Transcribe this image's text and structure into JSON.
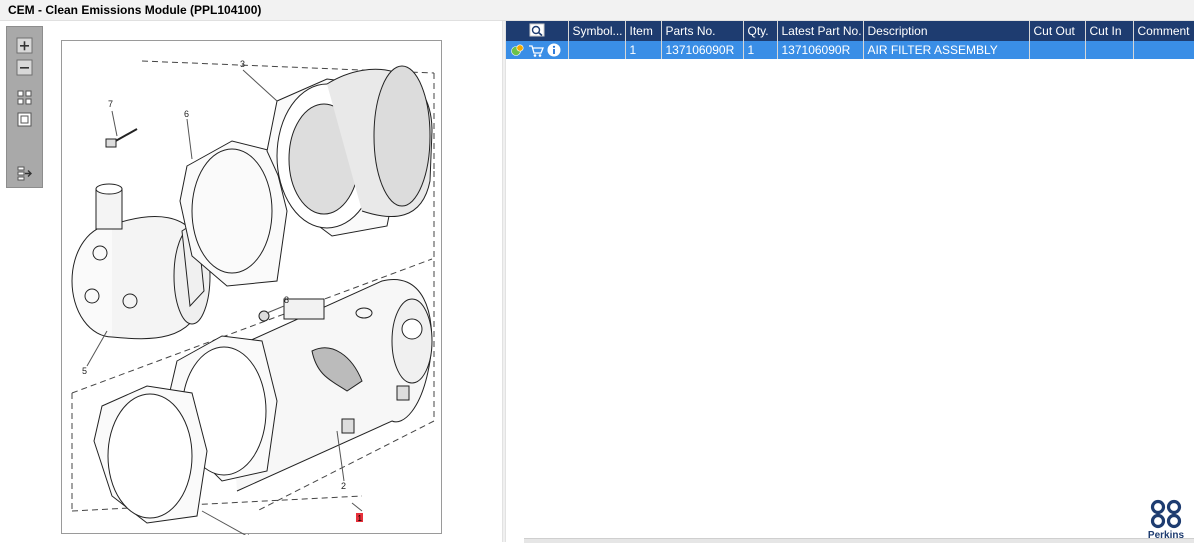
{
  "window": {
    "title": "CEM - Clean Emissions Module (PPL104100)"
  },
  "toolbar": {
    "icons": [
      "zoom-in-icon",
      "zoom-out-icon",
      "fit-view-icon",
      "actual-size-icon",
      "export-list-icon"
    ]
  },
  "drawing": {
    "callouts": [
      "1",
      "2",
      "3",
      "4",
      "5",
      "6",
      "7",
      "8"
    ],
    "highlight_color": "#e8303a"
  },
  "table": {
    "columns": [
      "",
      "Symbol...",
      "Item",
      "Parts No.",
      "Qty.",
      "Latest Part No.",
      "Description",
      "Cut Out",
      "Cut In",
      "Comment"
    ],
    "rows": [
      {
        "icons": [
          "parts-tree-icon",
          "cart-icon",
          "info-icon"
        ],
        "symbol": "",
        "item": "1",
        "parts_no": "137106090R",
        "qty": "1",
        "latest_part_no": "137106090R",
        "description": "AIR FILTER ASSEMBLY",
        "cut_out": "",
        "cut_in": "",
        "comment": ""
      }
    ]
  },
  "brand": {
    "name": "Perkins",
    "color": "#1e3c70"
  },
  "colors": {
    "header_bg": "#1e3c70",
    "row_selected": "#3a8ee6"
  }
}
